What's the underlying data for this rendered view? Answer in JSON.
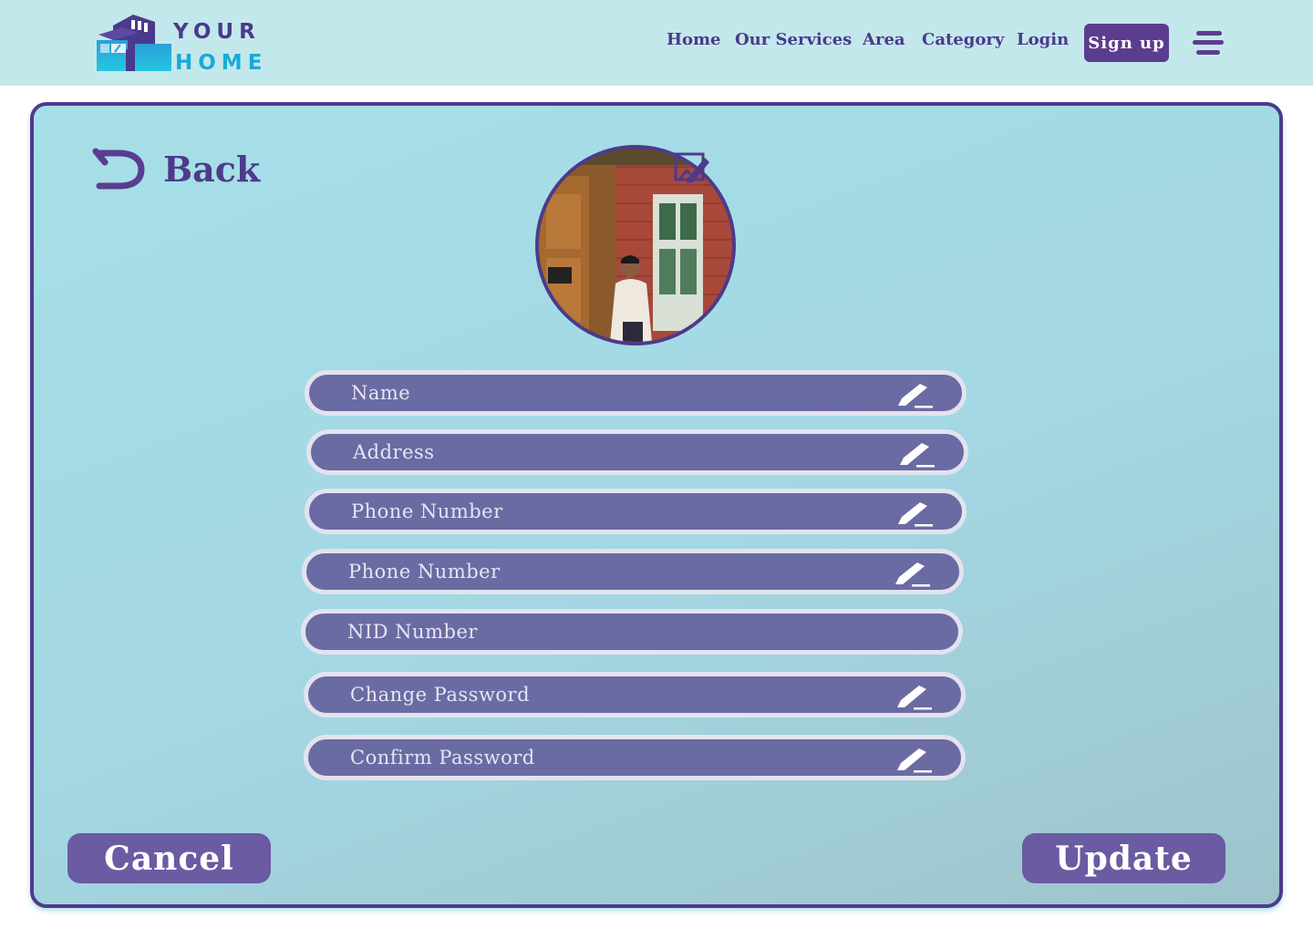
{
  "header": {
    "logo": {
      "line1": "YOUR",
      "line2": "HOME"
    },
    "nav": [
      "Home",
      "Our Services",
      "Area",
      "Category",
      "Login"
    ],
    "signup_label": "Sign up",
    "menu_icon": "hamburger-icon"
  },
  "profile": {
    "back_label": "Back",
    "back_icon": "undo-arrow-icon",
    "edit_photo_icon": "edit-image-icon",
    "fields": [
      {
        "placeholder": "Name",
        "editable": true
      },
      {
        "placeholder": "Address",
        "editable": true
      },
      {
        "placeholder": "Phone Number",
        "editable": true
      },
      {
        "placeholder": "Phone Number",
        "editable": true
      },
      {
        "placeholder": "NID Number",
        "editable": false
      },
      {
        "placeholder": "Change Password",
        "editable": true
      },
      {
        "placeholder": "Confirm Password",
        "editable": true
      }
    ],
    "cancel_label": "Cancel",
    "update_label": "Update"
  },
  "colors": {
    "header_bg": "#c3e8ec",
    "brand_purple": "#4e3a8a",
    "field_bg": "#6a6ba3",
    "button_bg": "#6a5ba2",
    "logo_blue": "#1aa9d8"
  }
}
